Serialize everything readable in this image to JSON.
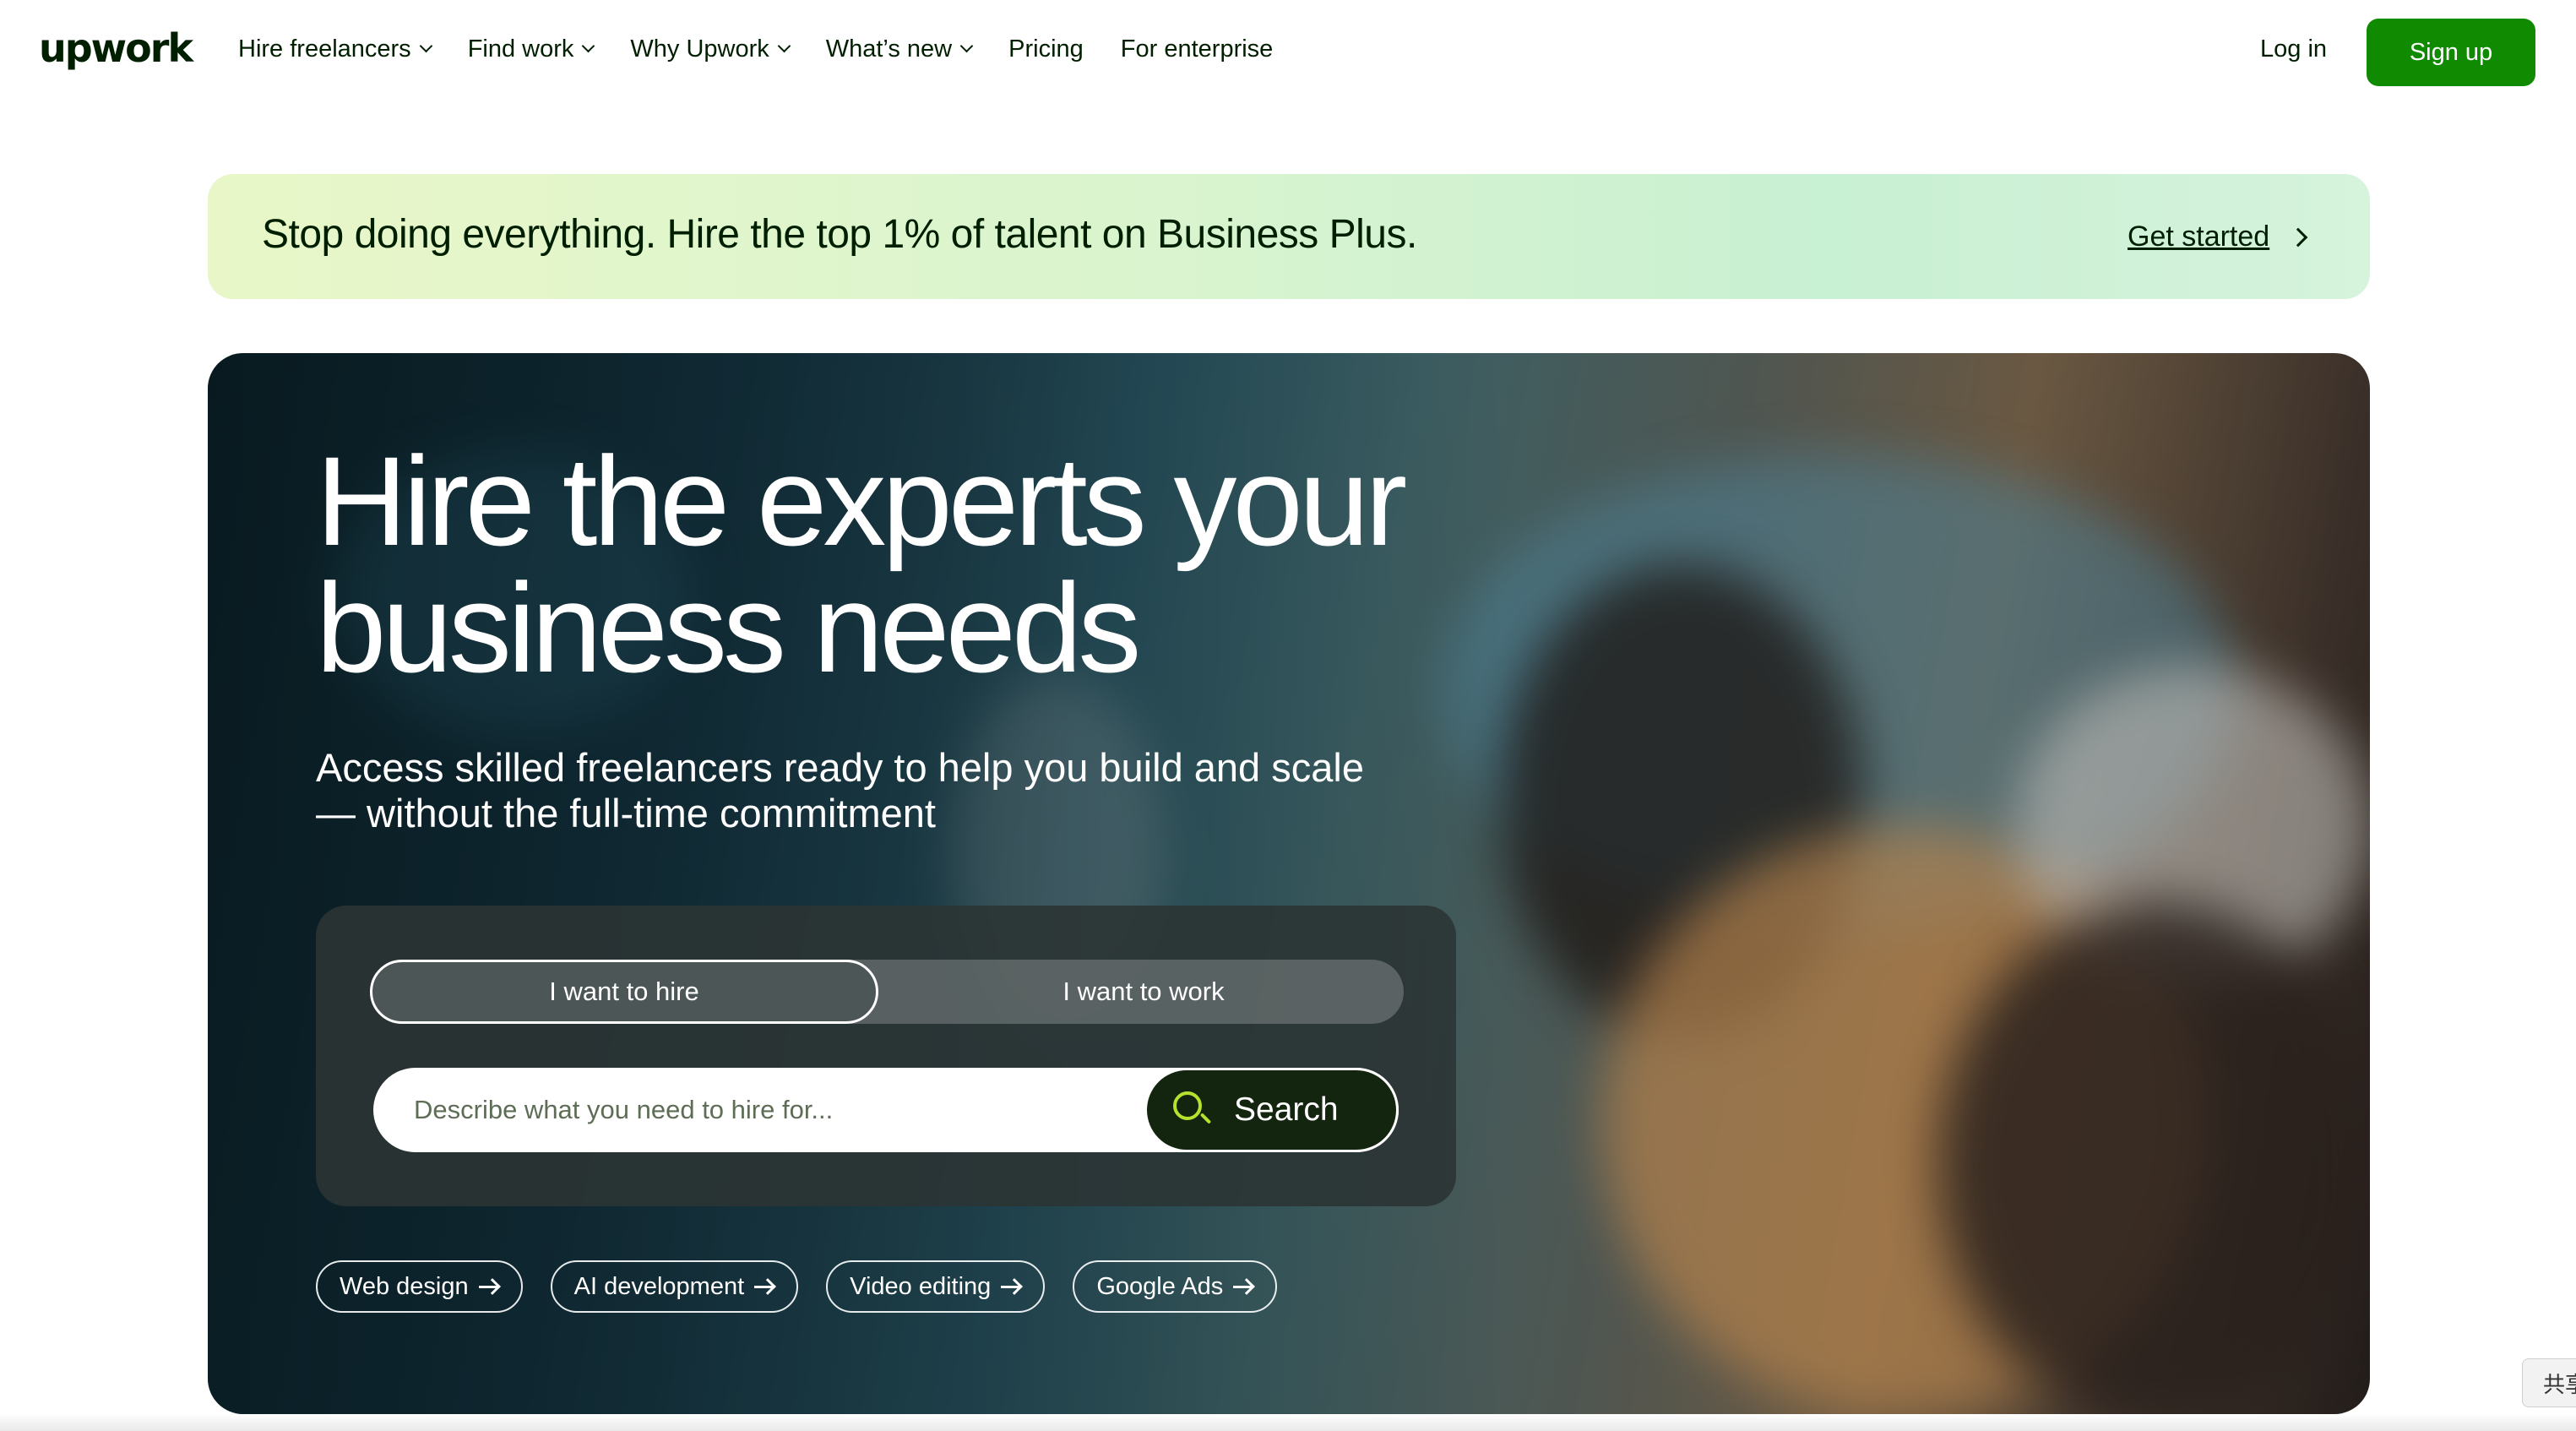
{
  "nav": {
    "logo": "upwork",
    "items": [
      {
        "label": "Hire freelancers",
        "dropdown": true
      },
      {
        "label": "Find work",
        "dropdown": true
      },
      {
        "label": "Why Upwork",
        "dropdown": true
      },
      {
        "label": "What’s new",
        "dropdown": true
      },
      {
        "label": "Pricing",
        "dropdown": false
      },
      {
        "label": "For enterprise",
        "dropdown": false
      }
    ],
    "login": "Log in",
    "signup": "Sign up"
  },
  "promo": {
    "text": "Stop doing everything. Hire the top 1% of talent on Business Plus.",
    "link": "Get started"
  },
  "hero": {
    "title_line1": "Hire the experts your",
    "title_line2": "business needs",
    "subtitle_line1": "Access skilled freelancers ready to help you build and scale",
    "subtitle_line2": "— without the full-time commitment",
    "toggle": {
      "hire": "I want to hire",
      "work": "I want to work"
    },
    "search": {
      "placeholder": "Describe what you need to hire for...",
      "value": "",
      "button": "Search"
    },
    "chips": [
      "Web design",
      "AI development",
      "Video editing",
      "Google Ads"
    ]
  },
  "ime_indicator": "共享",
  "colors": {
    "brand_green": "#108a00",
    "search_button": "#13250f",
    "search_icon": "#b6e22e",
    "text": "#001e00"
  }
}
